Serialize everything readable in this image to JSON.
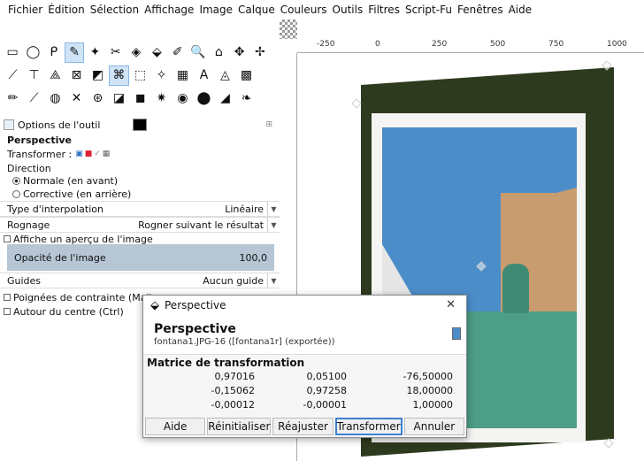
{
  "menubar": [
    "Fichier",
    "Édition",
    "Sélection",
    "Affichage",
    "Image",
    "Calque",
    "Couleurs",
    "Outils",
    "Filtres",
    "Script-Fu",
    "Fenêtres",
    "Aide"
  ],
  "tools": {
    "row1": [
      "▭",
      "◯",
      "ᑭ",
      "✎",
      "✦",
      "✂",
      "◈",
      "⬙",
      "✐",
      "🔍",
      "⌂",
      "✥",
      "✢"
    ],
    "row2": [
      "⟋",
      "⊤",
      "⟁",
      "⊠",
      "◩",
      "⌘",
      "⬚",
      "✧",
      "▦",
      "A",
      "◬",
      "▩"
    ],
    "row3": [
      "✏",
      "⟋",
      "◍",
      "✕",
      "⊛",
      "◪",
      "◼",
      "✷",
      "◉",
      "⬤",
      "◢",
      "❧"
    ]
  },
  "options": {
    "tab_label": "Options de l'outil",
    "tool_title": "Perspective",
    "transformer_label": "Transformer :",
    "direction_label": "Direction",
    "dir_normal": "Normale (en avant)",
    "dir_corrective": "Corrective (en arrière)",
    "interp_label": "Type d'interpolation",
    "interp_value": "Linéaire",
    "clip_label": "Rognage",
    "clip_value": "Rogner suivant le résultat",
    "preview_label": "Affiche un aperçu de l'image",
    "opacity_label": "Opacité de l'image",
    "opacity_value": "100,0",
    "guides_label": "Guides",
    "guides_value": "Aucun guide",
    "constraint_label": "Poignées de contrainte (Maj)",
    "center_label": "Autour du centre (Ctrl)"
  },
  "ruler": {
    "ticks": [
      "-250",
      "0",
      "250",
      "500",
      "750",
      "1000"
    ]
  },
  "dialog": {
    "window_title": "Perspective",
    "heading": "Perspective",
    "subtitle": "fontana1.JPG-16 ([fontana1r] (exportée))",
    "matrix_title": "Matrice de transformation",
    "matrix": [
      [
        "0,97016",
        "0,05100",
        "-76,50000"
      ],
      [
        "-0,15062",
        "0,97258",
        "18,00000"
      ],
      [
        "-0,00012",
        "-0,00001",
        "1,00000"
      ]
    ],
    "buttons": {
      "help": "Aide",
      "reset": "Réinitialiser",
      "readjust": "Réajuster",
      "transform": "Transformer",
      "cancel": "Annuler"
    }
  }
}
